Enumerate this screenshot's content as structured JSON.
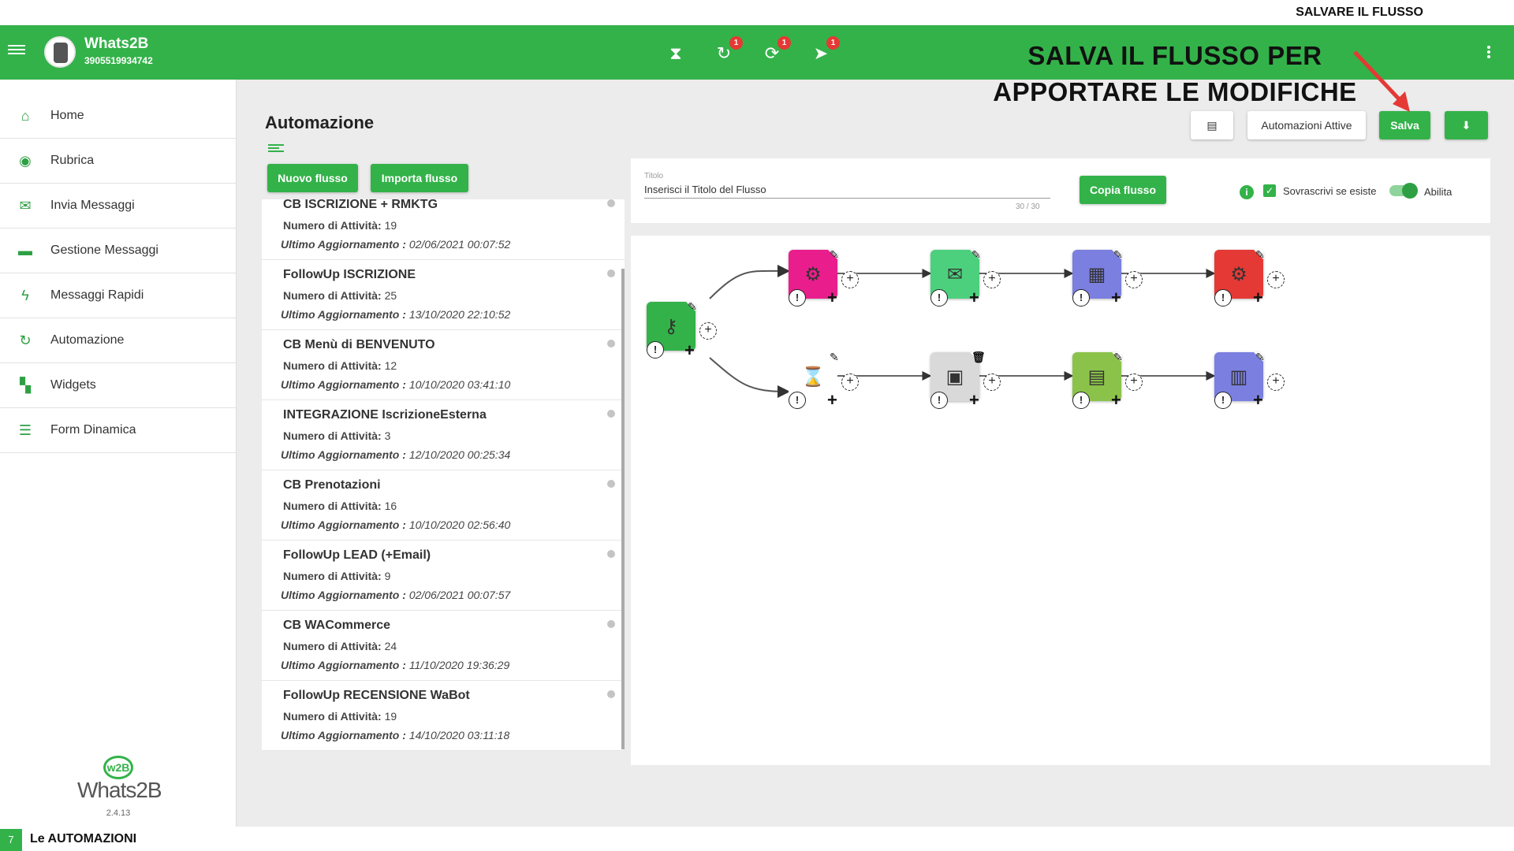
{
  "slide": {
    "top_title": "SALVARE IL FLUSSO",
    "callout_line1": "SALVA IL FLUSSO PER",
    "callout_line2": "APPORTARE LE MODIFICHE",
    "page_number": "7",
    "footer_title": "Le AUTOMAZIONI"
  },
  "appbar": {
    "brand": "Whats2B",
    "phone": "3905519934742",
    "icons": [
      {
        "name": "hourglass-icon",
        "badge": ""
      },
      {
        "name": "history-icon",
        "badge": "1"
      },
      {
        "name": "sync-icon",
        "badge": "1"
      },
      {
        "name": "scheduled-send-icon",
        "badge": "1"
      }
    ]
  },
  "sidebar": {
    "items": [
      {
        "label": "Home",
        "icon": "home-icon"
      },
      {
        "label": "Rubrica",
        "icon": "contacts-icon"
      },
      {
        "label": "Invia Messaggi",
        "icon": "mail-icon"
      },
      {
        "label": "Gestione Messaggi",
        "icon": "folder-icon"
      },
      {
        "label": "Messaggi Rapidi",
        "icon": "bolt-icon"
      },
      {
        "label": "Automazione",
        "icon": "refresh-icon"
      },
      {
        "label": "Widgets",
        "icon": "widgets-icon"
      },
      {
        "label": "Form Dinamica",
        "icon": "form-icon"
      }
    ],
    "logo_mark": "w2B",
    "logo_text": "Whats2B",
    "version": "2.4.13"
  },
  "main": {
    "title": "Automazione",
    "new_flow_label": "Nuovo flusso",
    "import_flow_label": "Importa flusso",
    "active_label": "Automazioni Attive",
    "save_label": "Salva",
    "copy_flow_label": "Copia flusso",
    "title_field_label": "Titolo",
    "title_field_value": "Inserisci il Titolo del Flusso",
    "title_counter": "30 / 30",
    "overwrite_label": "Sovrascrivi se esiste",
    "enable_label": "Abilita",
    "activities_prefix": "Numero di Attività:",
    "updated_prefix": "Ultimo Aggiornamento :",
    "flows": [
      {
        "name": "CB ISCRIZIONE + RMKTG",
        "activities": "19",
        "updated": "02/06/2021 00:07:52"
      },
      {
        "name": "FollowUp ISCRIZIONE",
        "activities": "25",
        "updated": "13/10/2020 22:10:52"
      },
      {
        "name": "CB Menù di BENVENUTO",
        "activities": "12",
        "updated": "10/10/2020 03:41:10"
      },
      {
        "name": "INTEGRAZIONE IscrizioneEsterna",
        "activities": "3",
        "updated": "12/10/2020 00:25:34"
      },
      {
        "name": "CB Prenotazioni",
        "activities": "16",
        "updated": "10/10/2020 02:56:40"
      },
      {
        "name": "FollowUp LEAD (+Email)",
        "activities": "9",
        "updated": "02/06/2021 00:07:57"
      },
      {
        "name": "CB WACommerce",
        "activities": "24",
        "updated": "11/10/2020 19:36:29"
      },
      {
        "name": "FollowUp RECENSIONE WaBot",
        "activities": "19",
        "updated": "14/10/2020 03:11:18"
      }
    ]
  },
  "flow_nodes": [
    {
      "name": "trigger-node",
      "icon": "key-icon",
      "color": "#33b249",
      "glyph": "⚷"
    },
    {
      "name": "api-node",
      "icon": "api-icon",
      "color": "#e91e8c",
      "glyph": "⚙"
    },
    {
      "name": "message-node",
      "icon": "envelope-icon",
      "color": "#4cd07d",
      "glyph": "✉"
    },
    {
      "name": "calendar-node",
      "icon": "calendar-icon",
      "color": "#7b7fe0",
      "glyph": "▦"
    },
    {
      "name": "bot-node",
      "icon": "bot-icon",
      "color": "#e53935",
      "glyph": "⚙"
    },
    {
      "name": "wait-node",
      "icon": "hourglass-icon",
      "color": "#ffffff",
      "glyph": "⌛"
    },
    {
      "name": "save-node",
      "icon": "floppy-icon",
      "color": "#d9d9d9",
      "glyph": "💾"
    },
    {
      "name": "catalog-node",
      "icon": "catalog-icon",
      "color": "#8bc34a",
      "glyph": "▤"
    },
    {
      "name": "form-node",
      "icon": "form-icon",
      "color": "#7b7fe0",
      "glyph": "▥"
    }
  ]
}
